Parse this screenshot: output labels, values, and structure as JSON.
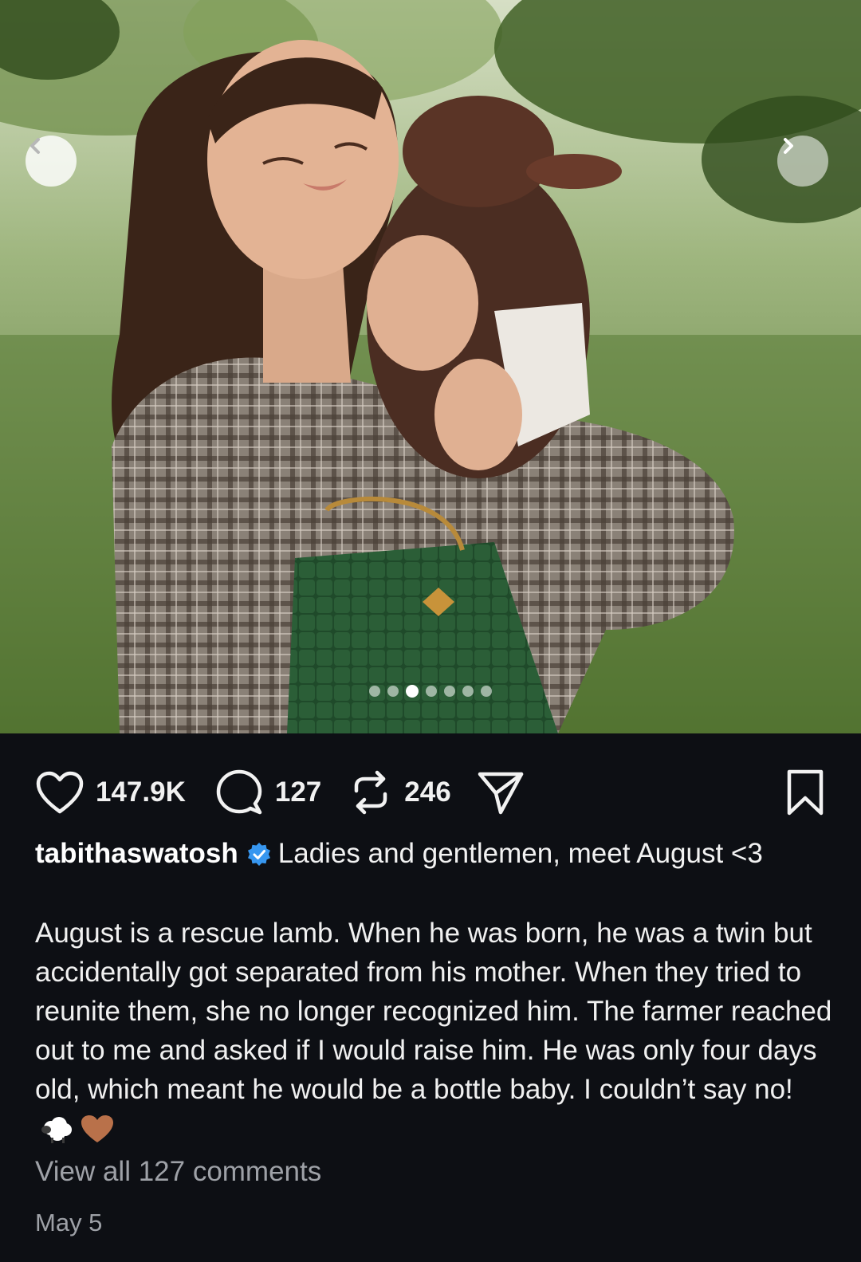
{
  "post": {
    "image_alt": "Woman in plaid coat hugging a brown lamb outdoors",
    "carousel": {
      "total": 7,
      "active_index": 2
    }
  },
  "actions": {
    "likes": "147.9K",
    "comments": "127",
    "reposts": "246"
  },
  "caption": {
    "username": "tabithaswatosh",
    "headline": "Ladies and gentlemen, meet August <3",
    "body": "August is a rescue lamb. When he was born, he was a twin but accidentally got separated from his mother. When they tried to reunite them, she no longer recognized him. The farmer reached out to me and asked if I would raise him. He was only four days old, which meant he would be a bottle baby. I couldn’t say no!",
    "emojis": [
      "sheep-emoji",
      "brown-heart-emoji"
    ]
  },
  "view_all_comments": "View all 127 comments",
  "date": "May 5",
  "colors": {
    "background": "#0d0f14",
    "text": "#f2f2f2",
    "muted": "#9ea1a7",
    "verified": "#3797f0",
    "heart": "#b9714a"
  }
}
